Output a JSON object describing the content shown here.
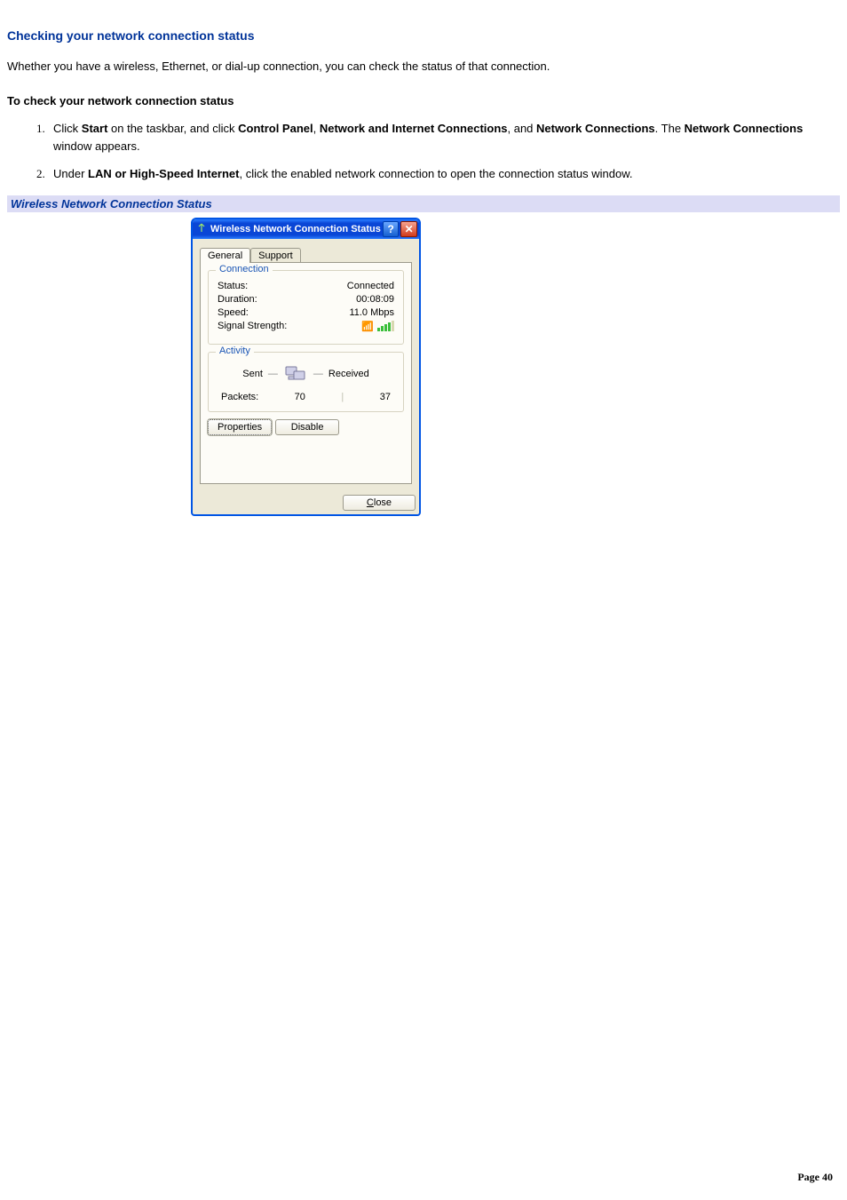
{
  "doc": {
    "heading": "Checking your network connection status",
    "intro": "Whether you have a wireless, Ethernet, or dial-up connection, you can check the status of that connection.",
    "procedure_title": "To check your network connection status",
    "steps": {
      "s1_pre": "Click ",
      "s1_b1": "Start",
      "s1_mid1": " on the taskbar, and click ",
      "s1_b2": "Control Panel",
      "s1_mid2": ", ",
      "s1_b3": "Network and Internet Connections",
      "s1_mid3": ", and ",
      "s1_b4": "Network Connections",
      "s1_mid4": ". The ",
      "s1_b5": "Network Connections",
      "s1_post": " window appears.",
      "s2_pre": "Under ",
      "s2_b1": "LAN or High-Speed Internet",
      "s2_post": ", click the enabled network connection to open the connection status window."
    },
    "figure_caption": "Wireless Network Connection Status"
  },
  "dialog": {
    "title": "Wireless Network Connection Status",
    "tabs": {
      "general": "General",
      "support": "Support"
    },
    "group_connection": "Connection",
    "group_activity": "Activity",
    "labels": {
      "status": "Status:",
      "duration": "Duration:",
      "speed": "Speed:",
      "signal": "Signal Strength:",
      "sent": "Sent",
      "received": "Received",
      "packets": "Packets:"
    },
    "values": {
      "status": "Connected",
      "duration": "00:08:09",
      "speed": "11.0 Mbps",
      "sent": "70",
      "received": "37"
    },
    "buttons": {
      "properties": "Properties",
      "disable": "Disable",
      "close_prefix": "C",
      "close_rest": "lose"
    }
  },
  "footer": {
    "label": "Page ",
    "number": "40"
  }
}
